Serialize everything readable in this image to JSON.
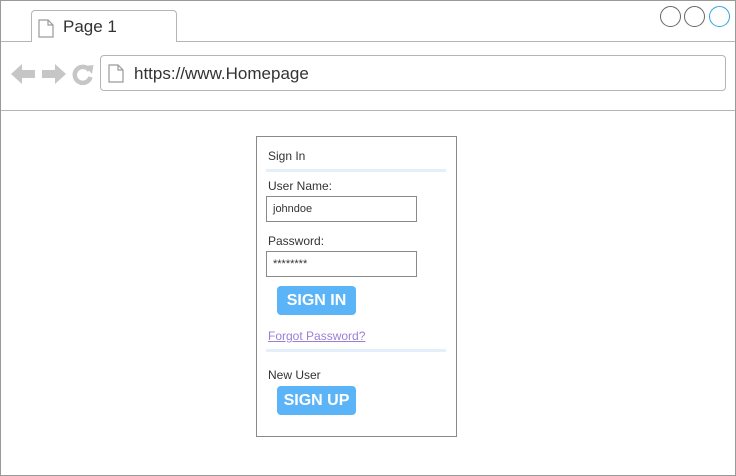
{
  "browser": {
    "tab": {
      "label": "Page 1",
      "icon": "page-icon"
    },
    "window_controls": [
      "minimize-circle",
      "maximize-circle",
      "close-circle"
    ],
    "nav": {
      "back_icon": "back-arrow-icon",
      "forward_icon": "forward-arrow-icon",
      "reload_icon": "reload-icon"
    },
    "address": {
      "url": "https://www.Homepage",
      "icon": "page-icon"
    }
  },
  "signin": {
    "heading": "Sign In",
    "username": {
      "label": "User Name:",
      "value": "johndoe"
    },
    "password": {
      "label": "Password:",
      "value": "********"
    },
    "signin_button": "SIGN IN",
    "forgot_link": "Forgot Password?",
    "new_user_label": "New User",
    "signup_button": "SIGN UP"
  },
  "colors": {
    "accent_button": "#5ab4f7",
    "link": "#9a7fd9",
    "divider": "#e3effa",
    "close_circle": "#2fa6e0"
  }
}
